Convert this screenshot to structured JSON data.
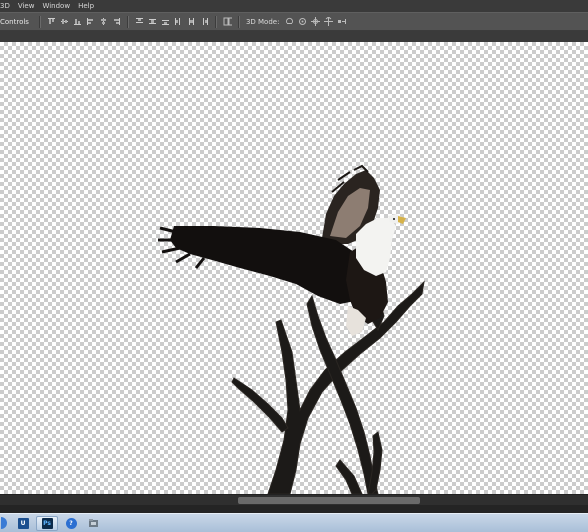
{
  "menubar": {
    "items": [
      "3D",
      "View",
      "Window",
      "Help"
    ]
  },
  "options": {
    "label": "Controls",
    "mode_label": "3D Mode:",
    "align_icons": [
      "align-top-icon",
      "align-vcenter-icon",
      "align-bottom-icon",
      "align-left-icon",
      "align-hcenter-icon",
      "align-right-icon"
    ],
    "distribute_icons": [
      "distribute-top-icon",
      "distribute-vcenter-icon",
      "distribute-bottom-icon",
      "distribute-left-icon",
      "distribute-hcenter-icon",
      "distribute-right-icon"
    ],
    "auto_align_icon": "auto-align-icon",
    "mode_icons": [
      "rotate-3d-icon",
      "roll-3d-icon",
      "pan-3d-icon",
      "slide-3d-icon",
      "scale-3d-icon"
    ]
  },
  "canvas": {
    "background": "transparent-checkerboard",
    "subject": "eagle-on-branch"
  },
  "taskbar": {
    "apps": [
      {
        "name": "start-icon",
        "label": ""
      },
      {
        "name": "ultraedit-icon",
        "label": "U"
      },
      {
        "name": "photoshop-icon",
        "label": "Ps"
      },
      {
        "name": "help-icon",
        "label": "?"
      },
      {
        "name": "folder-icon",
        "label": ""
      }
    ]
  },
  "colors": {
    "menubar": "#3a3a3a",
    "options_bar": "#535353",
    "checker_light": "#ffffff",
    "checker_dark": "#cccccc",
    "taskbar": "#b9cde4"
  }
}
